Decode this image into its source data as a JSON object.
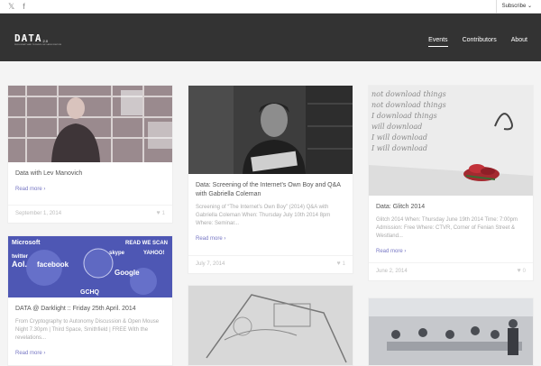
{
  "topbar": {
    "social": [
      {
        "icon": "twitter-icon",
        "glyph": "𝕏"
      },
      {
        "icon": "facebook-icon",
        "glyph": "f"
      }
    ],
    "subscribe_label": "Subscribe ⌄"
  },
  "header": {
    "logo_text": "DATA",
    "logo_version": "2.0",
    "logo_tagline": "DUBLIN ART AND TECHNOLOGY ASSOCIATION",
    "nav": [
      {
        "label": "Events",
        "active": true
      },
      {
        "label": "Contributors",
        "active": false
      },
      {
        "label": "About",
        "active": false
      }
    ]
  },
  "posts": [
    {
      "title": "Data with Lev Manovich",
      "excerpt": "",
      "more": "Read more ›",
      "date": "September 1, 2014",
      "likes": "1"
    },
    {
      "title": "Data: Screening of the Internet’s Own Boy and Q&A with Gabriella Coleman",
      "excerpt": "Screening of “The Internet’s Own Boy” (2014) Q&A with Gabriella Coleman When: Thursday July 10th 2014 8pm Where: Seminar...",
      "more": "Read more ›",
      "date": "July 7, 2014",
      "likes": "1"
    },
    {
      "title": "Data: Glitch 2014",
      "excerpt": "Glitch 2014 When: Thursday June 19th 2014 Time: 7:00pm Admission: Free Where: CTVR, Corner of Fenian Street & Westland...",
      "more": "Read more ›",
      "date": "June 2, 2014",
      "likes": "0"
    },
    {
      "title": "DATA @ Darklight :: Friday 25th April. 2014",
      "excerpt": "From Cryptography to Autonomy Discussion & Open Mouse Night 7.30pm | Third Space, Smithfield | FREE With the revelations...",
      "more": "Read more ›",
      "date": "",
      "likes": ""
    }
  ],
  "collage_words": [
    "Microsoft",
    "Aol.",
    "facebook",
    "twitter",
    "skype",
    "YAHOO!",
    "Google",
    "GCHQ",
    "READ WE SCAN"
  ],
  "wall_text": [
    "not download things",
    "not download things",
    "I download things",
    "will download",
    "I will download",
    "I will download"
  ]
}
